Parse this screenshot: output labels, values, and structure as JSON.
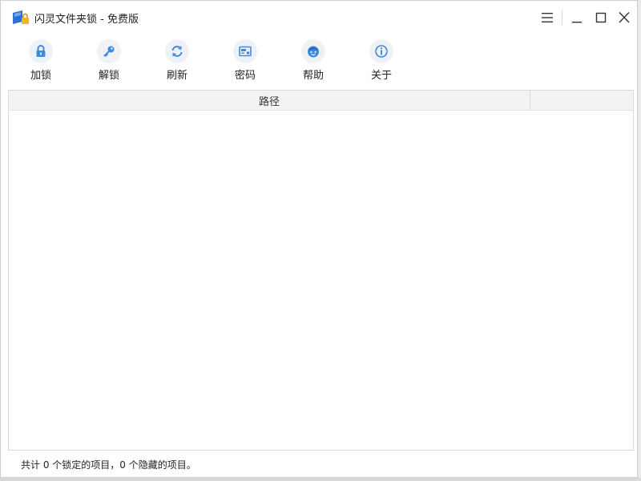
{
  "window": {
    "title": "闪灵文件夹锁 - 免费版"
  },
  "titlebar_buttons": {
    "menu": "menu-icon",
    "minimize": "minimize-icon",
    "maximize": "maximize-icon",
    "close": "close-icon"
  },
  "toolbar": {
    "items": [
      {
        "label": "加锁",
        "icon": "lock-icon"
      },
      {
        "label": "解锁",
        "icon": "key-icon"
      },
      {
        "label": "刷新",
        "icon": "refresh-icon"
      },
      {
        "label": "密码",
        "icon": "password-card-icon"
      },
      {
        "label": "帮助",
        "icon": "help-face-icon"
      },
      {
        "label": "关于",
        "icon": "info-icon"
      }
    ]
  },
  "list": {
    "columns": [
      "路径",
      ""
    ],
    "rows": []
  },
  "status": {
    "text": "共计 0 个锁定的项目，0 个隐藏的项目。"
  },
  "colors": {
    "icon_blue": "#3d8be0",
    "icon_bg": "#eef2f7",
    "header_bg": "#f3f3f3"
  }
}
